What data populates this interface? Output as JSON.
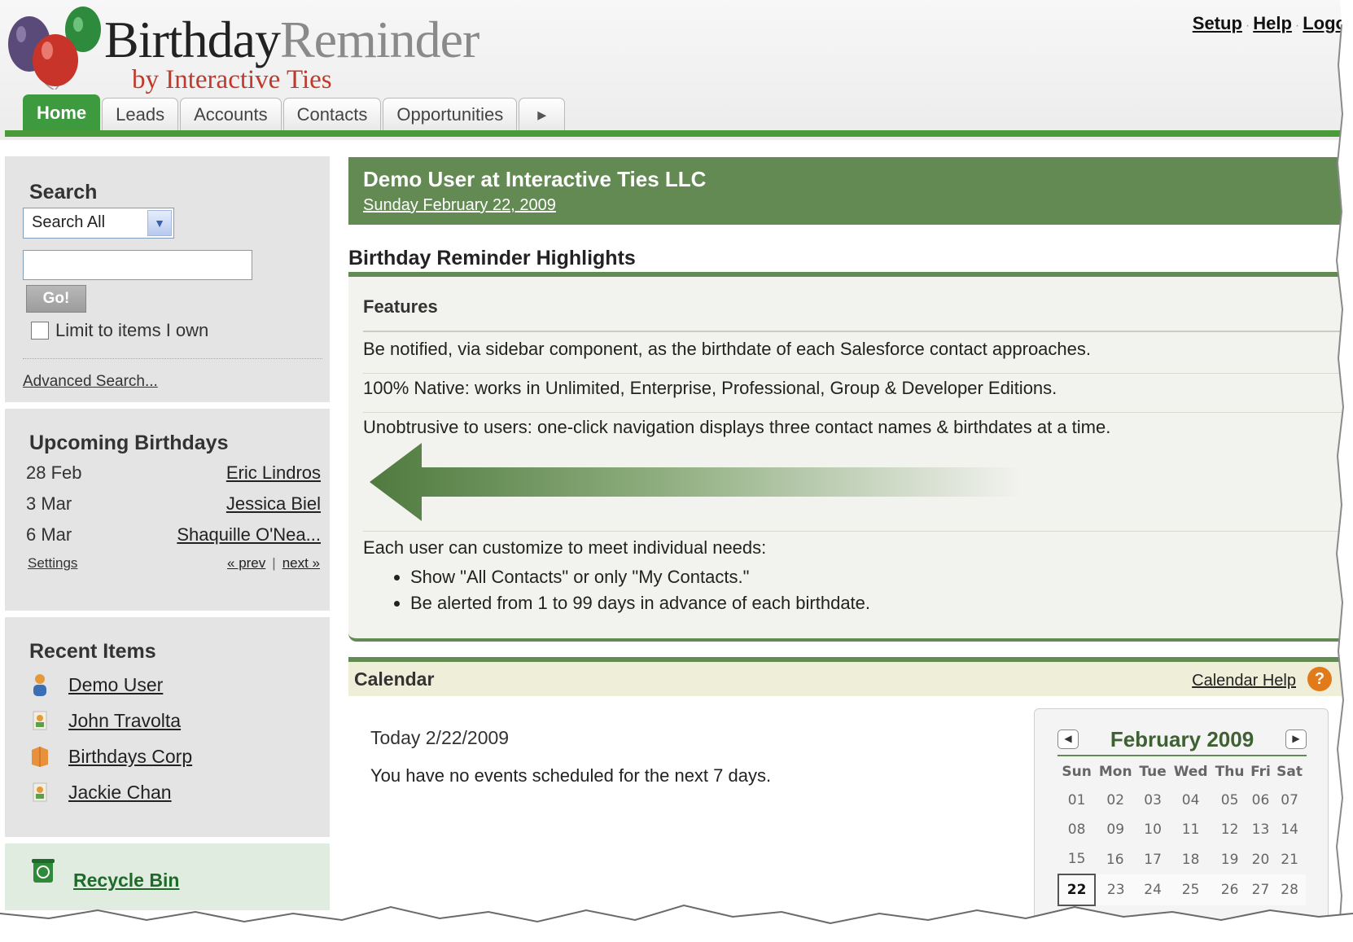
{
  "brand": {
    "title_part1": "Birthday",
    "title_part2": "Reminder",
    "byline": "by Interactive Ties"
  },
  "toplinks": [
    "Setup",
    "Help",
    "Logo"
  ],
  "tabs": [
    "Home",
    "Leads",
    "Accounts",
    "Contacts",
    "Opportunities"
  ],
  "sidebar": {
    "search": {
      "title": "Search",
      "scope_selected": "Search All",
      "input_value": "",
      "go_label": "Go!",
      "limit_label": "Limit to items I own",
      "limit_checked": false,
      "advanced_label": "Advanced Search..."
    },
    "birthdays": {
      "title": "Upcoming Birthdays",
      "items": [
        {
          "date": "28 Feb",
          "name": "Eric Lindros"
        },
        {
          "date": "3 Mar",
          "name": "Jessica Biel"
        },
        {
          "date": "6 Mar",
          "name": "Shaquille O'Nea..."
        }
      ],
      "settings_label": "Settings",
      "prev_label": "« prev",
      "next_label": "next »"
    },
    "recent": {
      "title": "Recent Items",
      "items": [
        {
          "label": "Demo User",
          "icon": "user-icon"
        },
        {
          "label": "John Travolta",
          "icon": "contact-icon"
        },
        {
          "label": "Birthdays Corp",
          "icon": "account-icon"
        },
        {
          "label": "Jackie Chan",
          "icon": "contact-icon"
        }
      ]
    },
    "recycle_label": "Recycle Bin"
  },
  "welcome": {
    "name": "Demo User at Interactive Ties LLC",
    "date": "Sunday February 22, 2009"
  },
  "highlights": {
    "title": "Birthday Reminder Highlights",
    "features_label": "Features",
    "rows": [
      "Be notified, via sidebar component, as the birthdate of each Salesforce contact approaches.",
      "100% Native: works in Unlimited, Enterprise, Professional, Group & Developer Editions.",
      "Unobtrusive to users: one-click navigation displays three contact names & birthdates at a time."
    ],
    "customize_intro": "Each user can customize to meet individual needs:",
    "bullets": [
      "Show \"All Contacts\" or only \"My Contacts.\"",
      "Be alerted from 1 to 99 days in advance of each birthdate."
    ]
  },
  "calendar": {
    "title": "Calendar",
    "help_label": "Calendar Help",
    "today_label": "Today 2/22/2009",
    "no_events": "You have no events scheduled for the next 7 days.",
    "mini": {
      "month_label": "February 2009",
      "weekdays": [
        "Sun",
        "Mon",
        "Tue",
        "Wed",
        "Thu",
        "Fri",
        "Sat"
      ],
      "weeks": [
        [
          "01",
          "02",
          "03",
          "04",
          "05",
          "06",
          "07"
        ],
        [
          "08",
          "09",
          "10",
          "11",
          "12",
          "13",
          "14"
        ],
        [
          "15",
          "16",
          "17",
          "18",
          "19",
          "20",
          "21"
        ],
        [
          "22",
          "23",
          "24",
          "25",
          "26",
          "27",
          "28"
        ]
      ],
      "today": "22"
    }
  },
  "colors": {
    "header_green": "#628a52",
    "tab_green": "#3e9a3e",
    "sidebar_bg": "#e4e4e4"
  }
}
